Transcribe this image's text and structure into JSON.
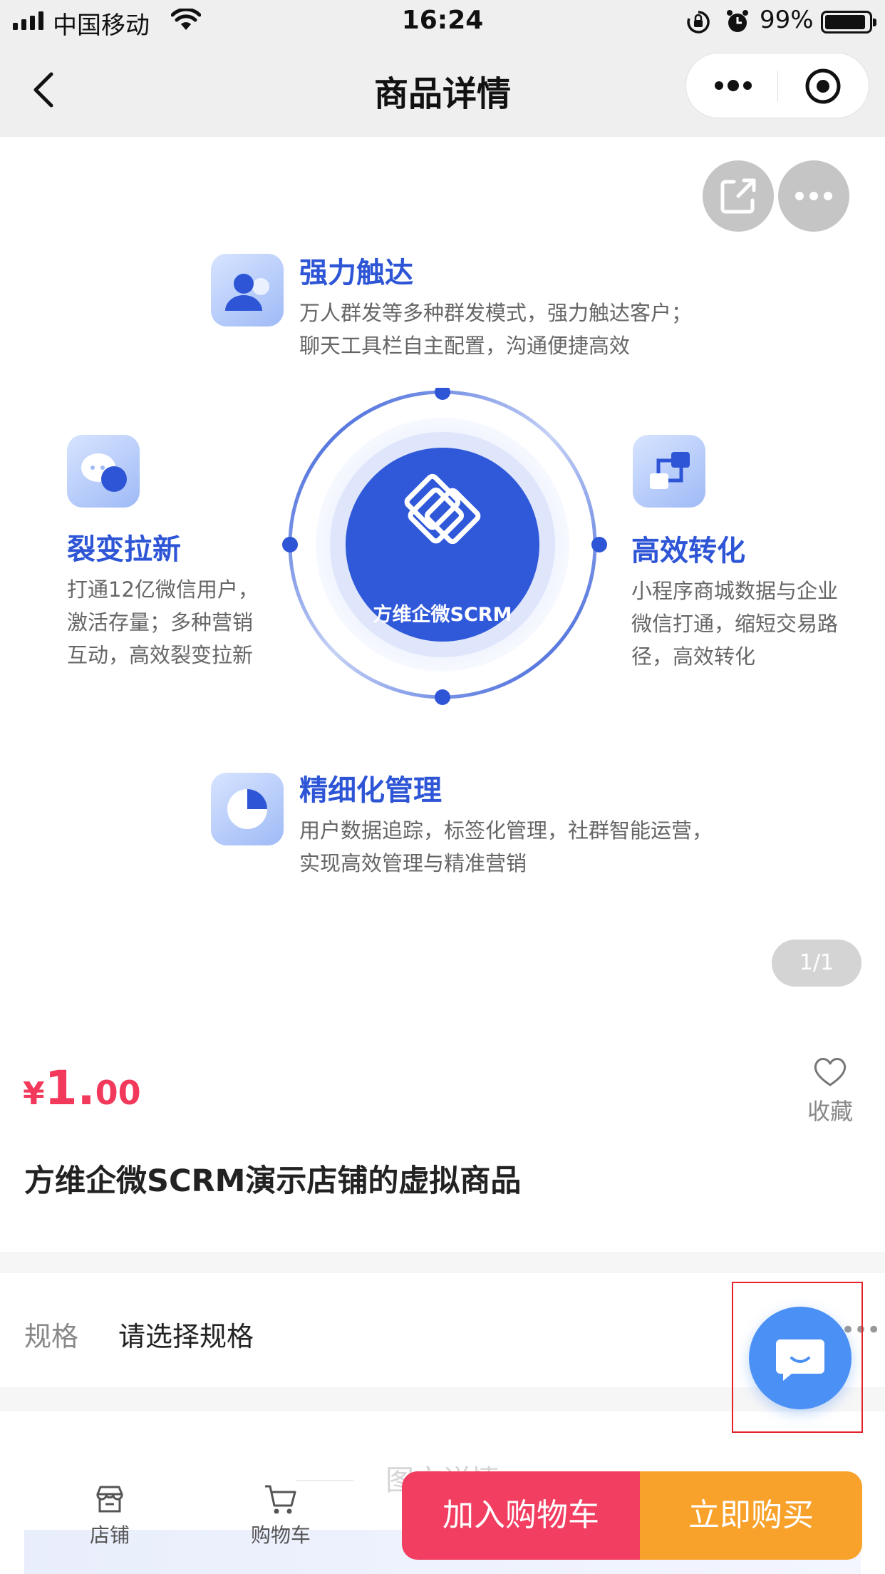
{
  "status_bar": {
    "carrier": "中国移动",
    "time": "16:24",
    "battery": "99%"
  },
  "nav": {
    "title": "商品详情"
  },
  "product_image": {
    "center_label": "方维企微SCRM",
    "features": [
      {
        "title": "强力触达",
        "desc": [
          "万人群发等多种群发模式，强力触达客户；",
          "聊天工具栏自主配置，沟通便捷高效"
        ]
      },
      {
        "title": "裂变拉新",
        "desc": [
          "打通12亿微信用户，",
          "激活存量；多种营销",
          "互动，高效裂变拉新"
        ]
      },
      {
        "title": "高效转化",
        "desc": [
          "小程序商城数据与企业",
          "微信打通，缩短交易路",
          "径，高效转化"
        ]
      },
      {
        "title": "精细化管理",
        "desc": [
          "用户数据追踪，标签化管理，社群智能运营，",
          "实现高效管理与精准营销"
        ]
      }
    ],
    "page_indicator": "1/1"
  },
  "product": {
    "price_currency": "¥",
    "price_integer": "1.",
    "price_decimal": "00",
    "favorite_label": "收藏",
    "title": "方维企微SCRM演示店铺的虚拟商品"
  },
  "spec": {
    "label": "规格",
    "value": "请选择规格"
  },
  "detail": {
    "heading": "图文详情"
  },
  "bottom_bar": {
    "store_label": "店铺",
    "cart_label": "购物车",
    "add_to_cart": "加入购物车",
    "buy_now": "立即购买"
  },
  "colors": {
    "accent_blue": "#2d55d6",
    "price_red": "#f2395b",
    "cart_button": "#f23f61",
    "buy_button": "#f8a22c",
    "chat_button": "#4a90f5"
  }
}
